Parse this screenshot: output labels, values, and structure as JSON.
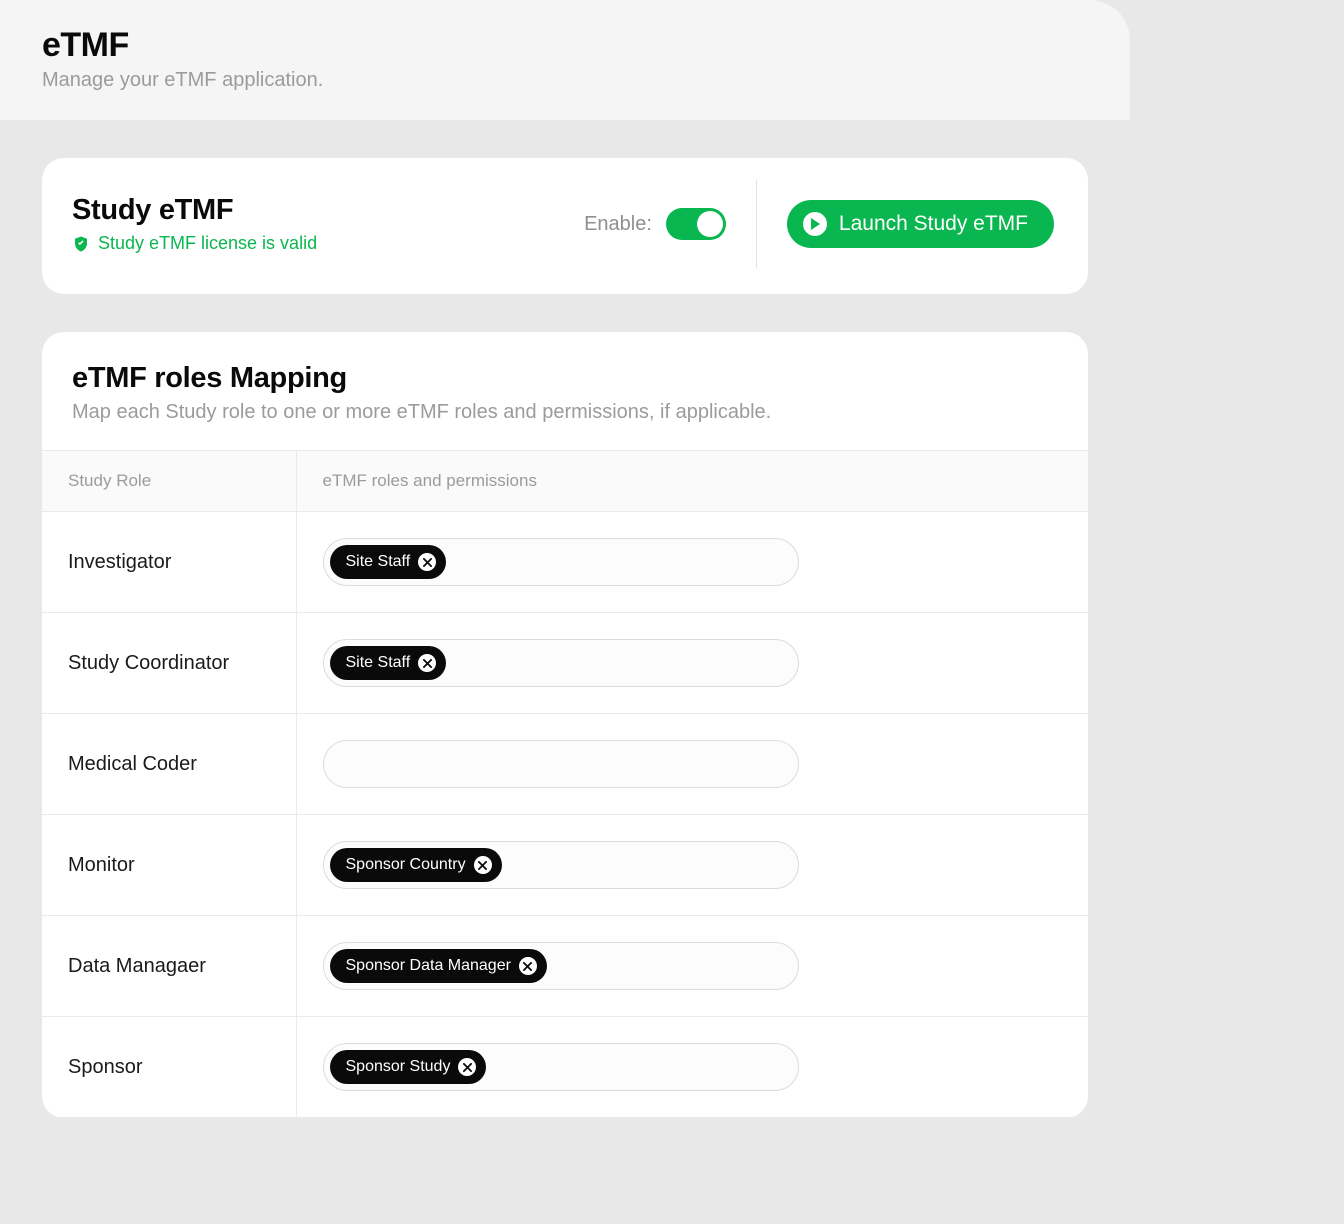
{
  "header": {
    "title": "eTMF",
    "subtitle": "Manage your eTMF application."
  },
  "statusCard": {
    "title": "Study eTMF",
    "licenseText": "Study eTMF license is valid",
    "enableLabel": "Enable:",
    "enabled": true,
    "launchLabel": "Launch Study eTMF"
  },
  "mapping": {
    "title": "eTMF roles Mapping",
    "subtitle": "Map each Study role to one or more eTMF roles and permissions, if applicable.",
    "columns": {
      "studyRole": "Study Role",
      "etmfRoles": "eTMF roles and permissions"
    },
    "rows": [
      {
        "studyRole": "Investigator",
        "tags": [
          "Site Staff"
        ]
      },
      {
        "studyRole": "Study Coordinator",
        "tags": [
          "Site Staff"
        ]
      },
      {
        "studyRole": "Medical Coder",
        "tags": []
      },
      {
        "studyRole": "Monitor",
        "tags": [
          "Sponsor Country"
        ]
      },
      {
        "studyRole": "Data Managaer",
        "tags": [
          "Sponsor Data Manager"
        ]
      },
      {
        "studyRole": "Sponsor",
        "tags": [
          "Sponsor Study"
        ]
      }
    ]
  }
}
